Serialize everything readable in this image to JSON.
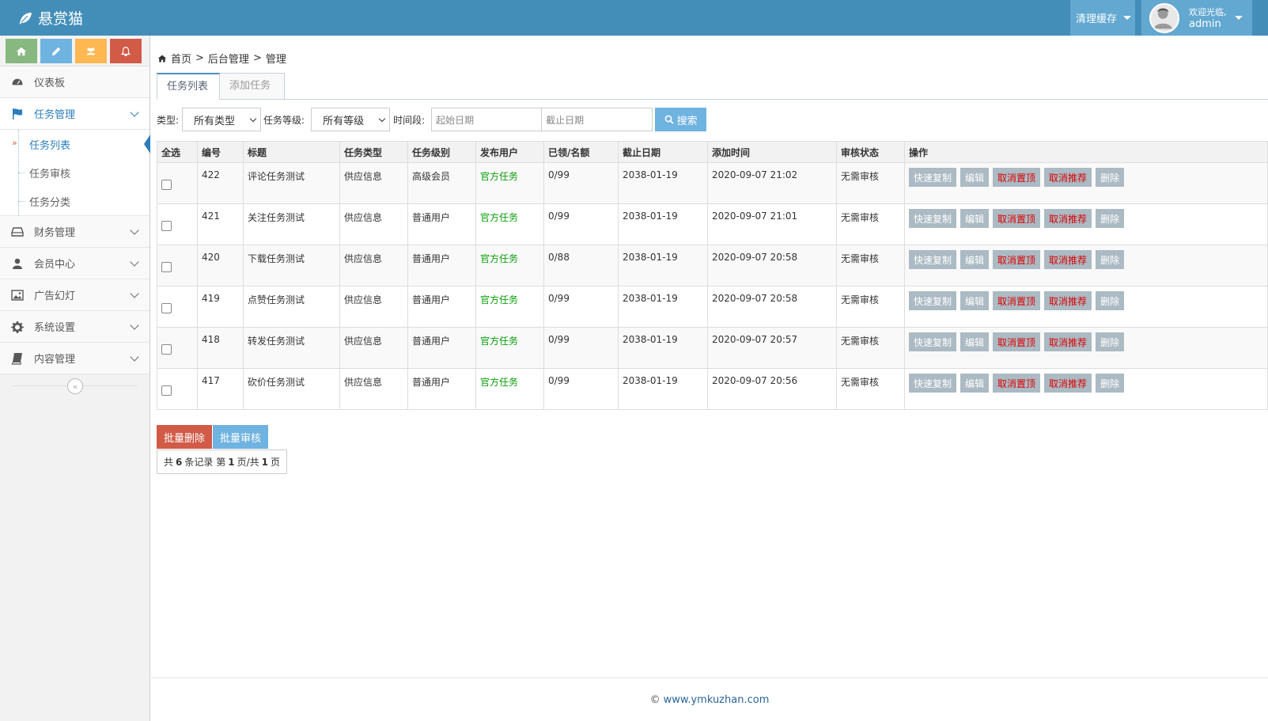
{
  "brand": {
    "name": "悬赏猫",
    "icon": "leaf-icon"
  },
  "header": {
    "cache_label": "清理缓存",
    "welcome": "欢迎光临,",
    "username": "admin"
  },
  "colors": {
    "topbar": "#438eb9",
    "shortcut_green": "#87b87f",
    "shortcut_blue": "#6fb3e0",
    "shortcut_orange": "#ffb752",
    "shortcut_red": "#d15b47",
    "accent": "#2b7dbc"
  },
  "sidebar": {
    "shortcuts": [
      "home-icon",
      "pencil-icon",
      "users-icon",
      "bell-icon"
    ],
    "items": [
      {
        "label": "仪表板",
        "icon": "dashboard-icon"
      },
      {
        "label": "任务管理",
        "icon": "flag-icon",
        "active": true,
        "sub": [
          {
            "label": "任务列表",
            "active": true
          },
          {
            "label": "任务审核"
          },
          {
            "label": "任务分类"
          }
        ]
      },
      {
        "label": "财务管理",
        "icon": "hdd-icon"
      },
      {
        "label": "会员中心",
        "icon": "user-icon"
      },
      {
        "label": "广告幻灯",
        "icon": "picture-icon"
      },
      {
        "label": "系统设置",
        "icon": "cog-icon"
      },
      {
        "label": "内容管理",
        "icon": "book-icon"
      }
    ],
    "collapse_icon": "«"
  },
  "breadcrumb": {
    "home": "首页",
    "level2": "后台管理",
    "level3": "管理",
    "sep": ">"
  },
  "tabs": {
    "list": "任务列表",
    "add": "添加任务"
  },
  "filter": {
    "type_label": "类型:",
    "type_value": "所有类型",
    "level_label": "任务等级:",
    "level_value": "所有等级",
    "period_label": "时间段:",
    "start_placeholder": "起始日期",
    "end_placeholder": "截止日期",
    "search_label": "搜索"
  },
  "table": {
    "headers": [
      "全选",
      "编号",
      "标题",
      "任务类型",
      "任务级别",
      "发布用户",
      "已领/名额",
      "截止日期",
      "添加时间",
      "审核状态",
      "操作"
    ],
    "ops": [
      "快速复制",
      "编辑",
      "取消置顶",
      "取消推荐",
      "删除"
    ],
    "rows": [
      {
        "id": "422",
        "title": "评论任务测试",
        "type": "供应信息",
        "level": "高级会员",
        "publisher": "官方任务",
        "quota": "0/99",
        "deadline": "2038-01-19",
        "added": "2020-09-07 21:02",
        "status": "无需审核"
      },
      {
        "id": "421",
        "title": "关注任务测试",
        "type": "供应信息",
        "level": "普通用户",
        "publisher": "官方任务",
        "quota": "0/99",
        "deadline": "2038-01-19",
        "added": "2020-09-07 21:01",
        "status": "无需审核"
      },
      {
        "id": "420",
        "title": "下载任务测试",
        "type": "供应信息",
        "level": "普通用户",
        "publisher": "官方任务",
        "quota": "0/88",
        "deadline": "2038-01-19",
        "added": "2020-09-07 20:58",
        "status": "无需审核"
      },
      {
        "id": "419",
        "title": "点赞任务测试",
        "type": "供应信息",
        "level": "普通用户",
        "publisher": "官方任务",
        "quota": "0/99",
        "deadline": "2038-01-19",
        "added": "2020-09-07 20:58",
        "status": "无需审核"
      },
      {
        "id": "418",
        "title": "转发任务测试",
        "type": "供应信息",
        "level": "普通用户",
        "publisher": "官方任务",
        "quota": "0/99",
        "deadline": "2038-01-19",
        "added": "2020-09-07 20:57",
        "status": "无需审核"
      },
      {
        "id": "417",
        "title": "砍价任务测试",
        "type": "供应信息",
        "level": "普通用户",
        "publisher": "官方任务",
        "quota": "0/99",
        "deadline": "2038-01-19",
        "added": "2020-09-07 20:56",
        "status": "无需审核"
      }
    ]
  },
  "bulk": {
    "delete": "批量删除",
    "audit": "批量审核"
  },
  "pager": {
    "prefix": "共",
    "total": "6",
    "mid1": "条记录 第",
    "page": "1",
    "mid2": "页/共",
    "pages": "1",
    "suffix": "页"
  },
  "footer": {
    "copyright": "©",
    "site": "www.ymkuzhan.com"
  }
}
